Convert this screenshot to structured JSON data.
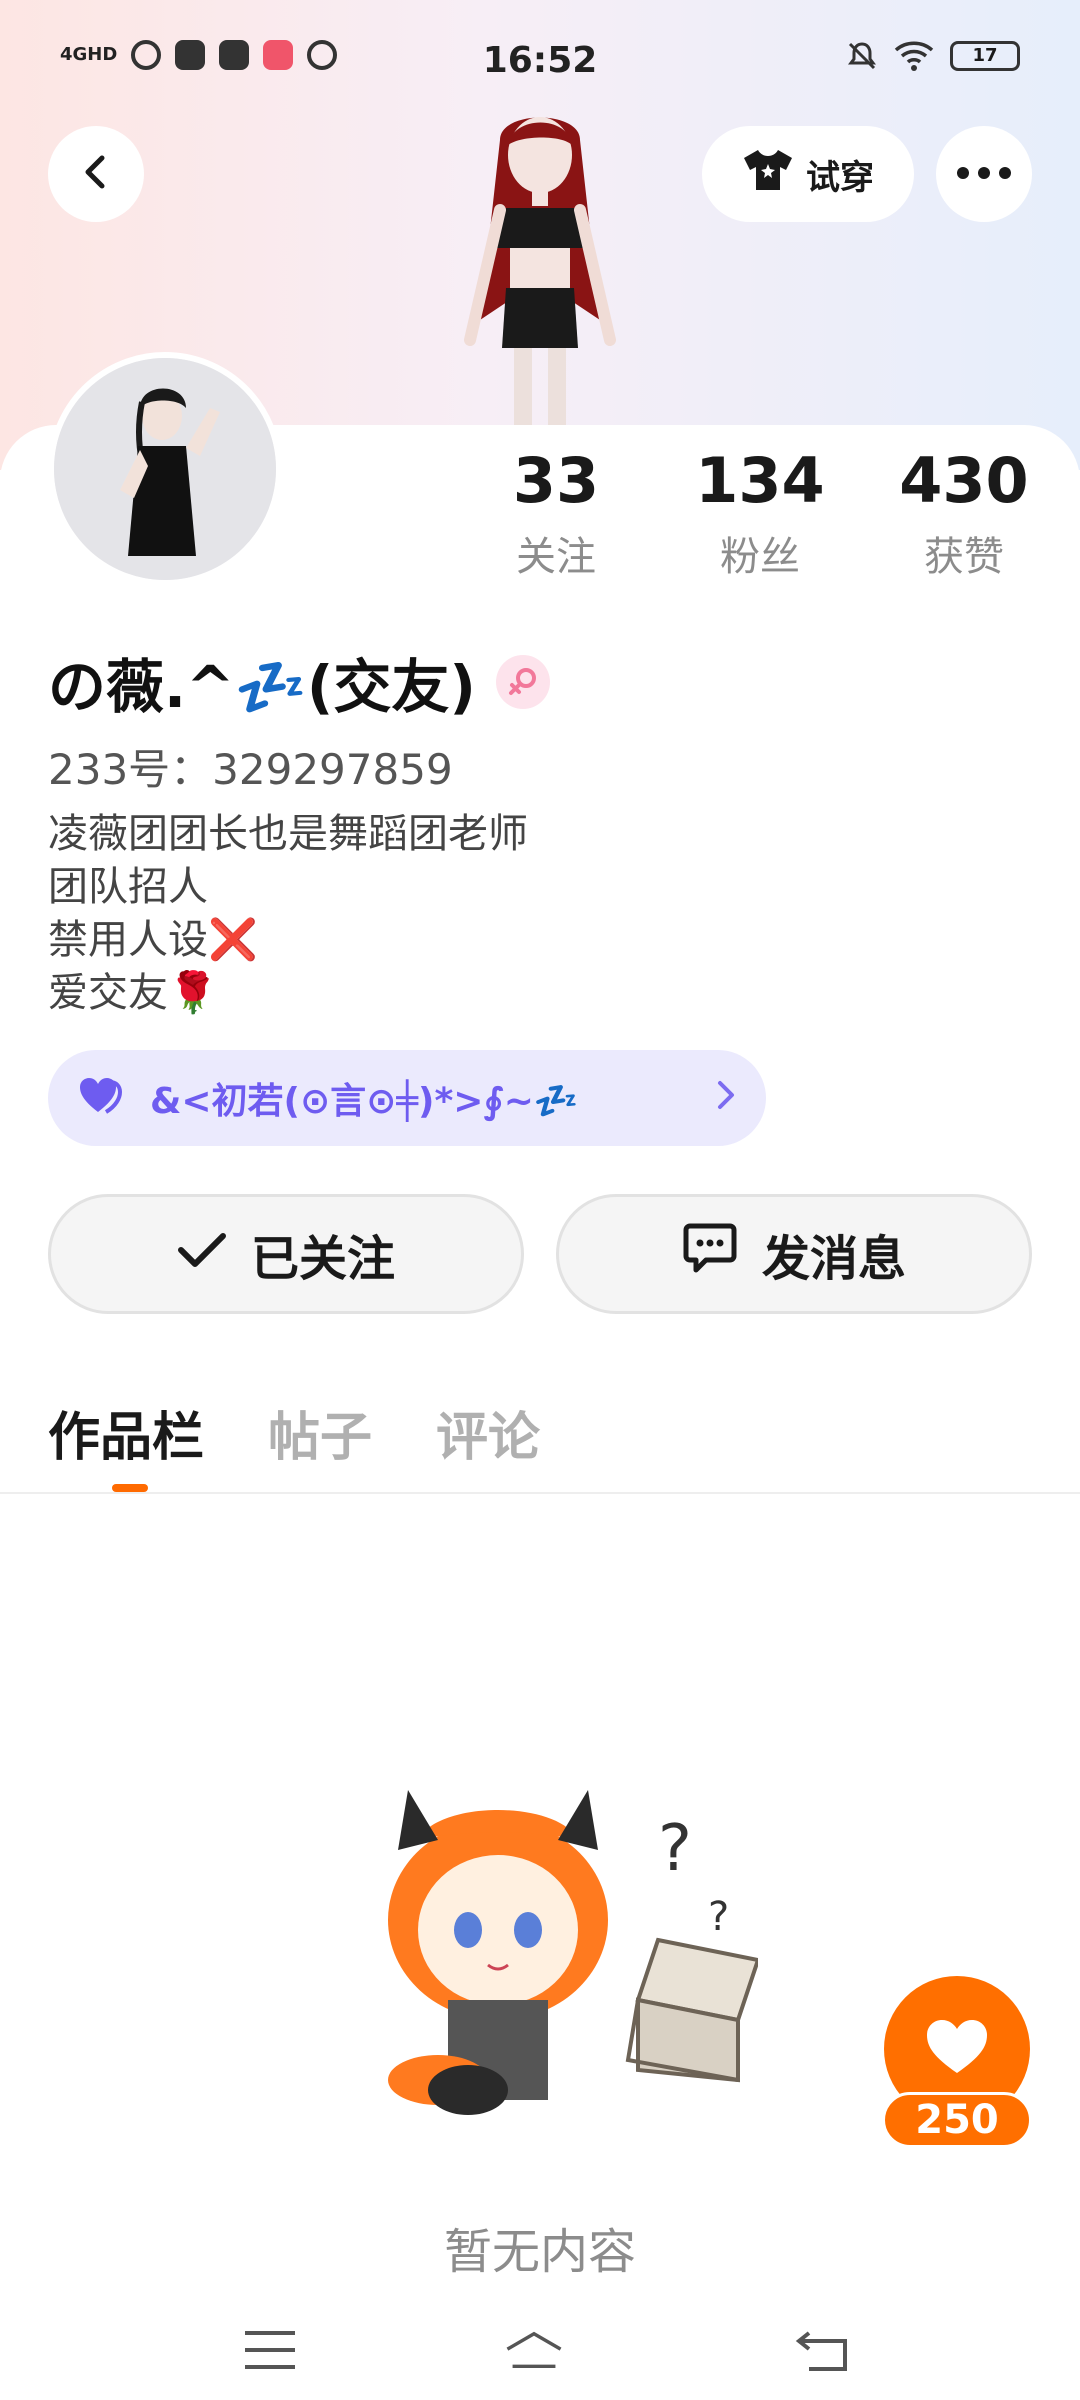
{
  "status_bar": {
    "network": "4GHD",
    "time": "16:52",
    "battery": "17"
  },
  "header": {
    "tryon_label": "试穿"
  },
  "stats": [
    {
      "value": "33",
      "label": "关注"
    },
    {
      "value": "134",
      "label": "粉丝"
    },
    {
      "value": "430",
      "label": "获赞"
    }
  ],
  "profile": {
    "name": "の薇.^💤(交友)",
    "id_text": "233号：329297859",
    "bio": [
      "凌薇团团长也是舞蹈团老师",
      "团队招人",
      "禁用人设❌",
      "爱交友🌹"
    ]
  },
  "group_tag": {
    "text": "&<初若(⊙言⊙╪)*>∮~💤"
  },
  "actions": {
    "follow_label": "已关注",
    "message_label": "发消息"
  },
  "tabs": [
    {
      "label": "作品栏",
      "active": true
    },
    {
      "label": "帖子",
      "active": false
    },
    {
      "label": "评论",
      "active": false
    }
  ],
  "empty_state": {
    "text": "暂无内容"
  },
  "like_fab": {
    "count": "250"
  },
  "colors": {
    "accent": "#ff6f00",
    "group_tag_bg": "#ebeafd",
    "group_tag_text": "#6e5cf0"
  }
}
